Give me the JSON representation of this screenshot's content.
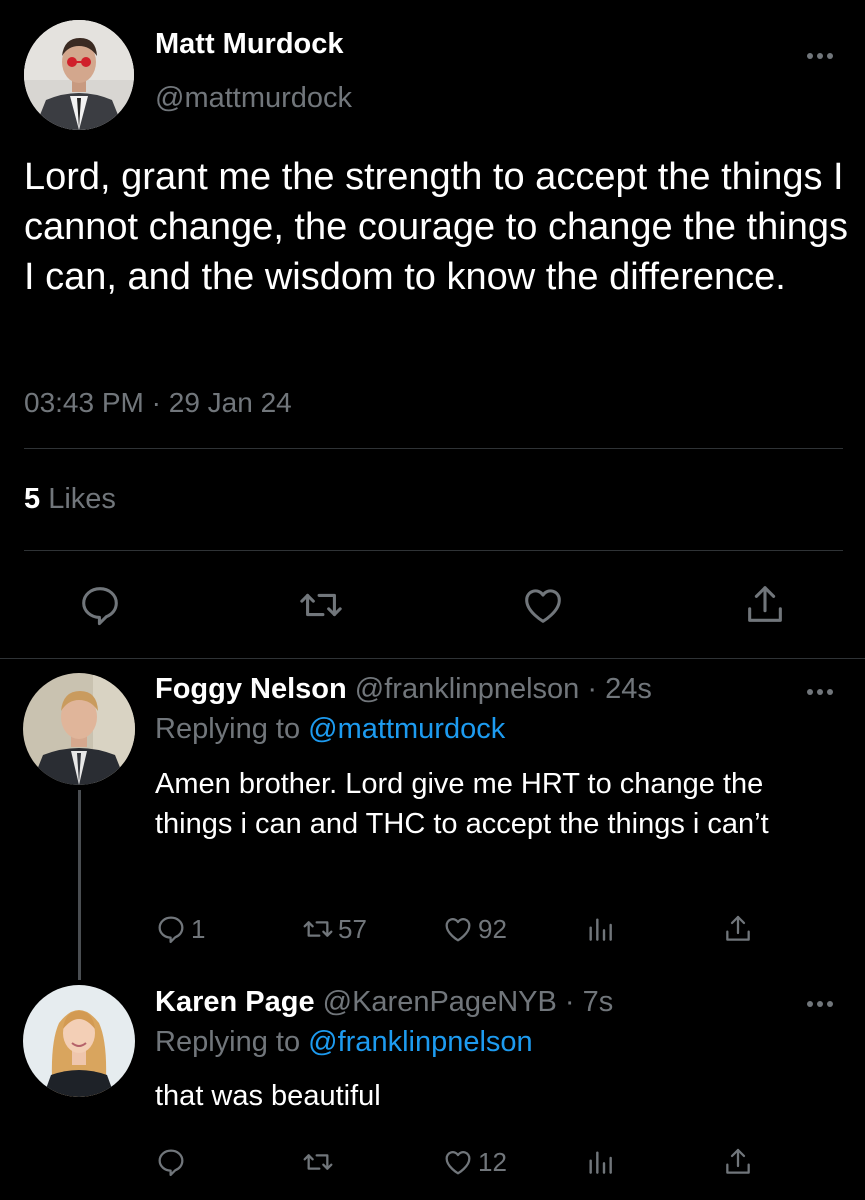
{
  "tweet": {
    "author_name": "Matt Murdock",
    "author_handle": "@mattmurdock",
    "text": "Lord, grant me the strength to accept the things I cannot change, the courage to change the things I can, and the wisdom to know the difference.",
    "time": "03:43 PM",
    "separator": "·",
    "date": "29 Jan 24",
    "likes_count": "5",
    "likes_label": "Likes"
  },
  "replies": [
    {
      "author_name": "Foggy Nelson",
      "author_handle": "@franklinpnelson",
      "age": "24s",
      "replying_prefix": "Replying to",
      "replying_to": "@mattmurdock",
      "text": "Amen brother. Lord give me HRT to change the things i can and THC to accept the things i can’t",
      "reply_count": "1",
      "retweet_count": "57",
      "like_count": "92"
    },
    {
      "author_name": "Karen Page",
      "author_handle": "@KarenPageNYB",
      "age": "7s",
      "replying_prefix": "Replying to",
      "replying_to": "@franklinpnelson",
      "text": "that was beautiful",
      "reply_count": "",
      "retweet_count": "",
      "like_count": "12"
    }
  ],
  "icons": {
    "more": "more-horizontal-icon",
    "reply": "reply-icon",
    "retweet": "retweet-icon",
    "like": "heart-icon",
    "share": "share-icon",
    "analytics": "analytics-icon"
  },
  "colors": {
    "background": "#000000",
    "text": "#e7e9ea",
    "secondary": "#71767b",
    "link": "#1d9bf0",
    "divider": "#2f3336"
  }
}
